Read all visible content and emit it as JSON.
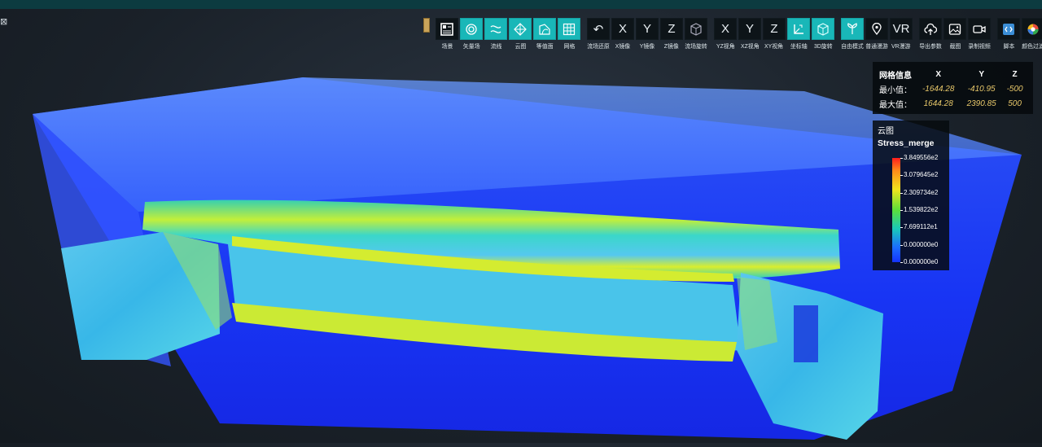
{
  "toolbar": {
    "groups": [
      [
        {
          "name": "scene",
          "label": "场景",
          "icon": "grid-layout-icon",
          "active": false
        },
        {
          "name": "vector-field",
          "label": "矢量场",
          "icon": "vector-swirl-icon",
          "active": true
        },
        {
          "name": "streamline",
          "label": "流线",
          "icon": "streamline-icon",
          "active": true
        },
        {
          "name": "contour",
          "label": "云图",
          "icon": "mesh-cloud-icon",
          "active": true
        },
        {
          "name": "isosurface",
          "label": "等值面",
          "icon": "isosurface-icon",
          "active": true
        },
        {
          "name": "mesh",
          "label": "网格",
          "icon": "mesh-grid-icon",
          "active": true
        }
      ],
      [
        {
          "name": "restore-flow",
          "label": "流场还原",
          "icon": "undo-arrow-icon",
          "glyph": "↶",
          "active": false
        },
        {
          "name": "x-mirror",
          "label": "X镜像",
          "glyph": "X",
          "active": false
        },
        {
          "name": "y-mirror",
          "label": "Y镜像",
          "glyph": "Y",
          "active": false
        },
        {
          "name": "z-mirror",
          "label": "Z镜像",
          "glyph": "Z",
          "active": false
        },
        {
          "name": "rotate-flow",
          "label": "流场旋转",
          "icon": "cube-rotate-icon",
          "active": false
        }
      ],
      [
        {
          "name": "yz-view",
          "label": "YZ视角",
          "glyph": "X",
          "active": false
        },
        {
          "name": "xz-view",
          "label": "XZ视角",
          "glyph": "Y",
          "active": false
        },
        {
          "name": "xy-view",
          "label": "XY视角",
          "glyph": "Z",
          "active": false
        },
        {
          "name": "axes",
          "label": "坐标轴",
          "icon": "axes-icon",
          "active": true
        },
        {
          "name": "rotate-3d",
          "label": "3D旋转",
          "icon": "cube-3d-icon",
          "active": true
        }
      ],
      [
        {
          "name": "free-mode",
          "label": "自由模式",
          "icon": "free-mode-icon",
          "active": true
        },
        {
          "name": "roam",
          "label": "普通漫游",
          "icon": "location-pin-icon",
          "active": false
        },
        {
          "name": "vr-roam",
          "label": "VR漫游",
          "glyph": "VR",
          "active": false
        }
      ],
      [
        {
          "name": "export-params",
          "label": "导出参数",
          "icon": "cloud-upload-icon",
          "active": false
        },
        {
          "name": "screenshot",
          "label": "截图",
          "icon": "image-icon",
          "active": false
        },
        {
          "name": "record-video",
          "label": "录制视频",
          "icon": "video-camera-icon",
          "active": false
        }
      ],
      [
        {
          "name": "script",
          "label": "脚本",
          "icon": "script-icon",
          "active": false
        },
        {
          "name": "color-filter",
          "label": "颜色过滤",
          "icon": "color-wheel-icon",
          "active": false
        }
      ]
    ]
  },
  "grid_info": {
    "title": "网格信息",
    "headers": [
      "X",
      "Y",
      "Z"
    ],
    "min_label": "最小值：",
    "min": [
      "-1644.28",
      "-410.95",
      "-500"
    ],
    "max_label": "最大值：",
    "max": [
      "1644.28",
      "2390.85",
      "500"
    ]
  },
  "legend": {
    "title": "云图",
    "variable": "Stress_merge",
    "labels": [
      "3.849556e2",
      "3.079645e2",
      "2.309734e2",
      "1.539822e2",
      "7.699112e1",
      "0.000000e0",
      "0.000000e0"
    ]
  },
  "colors": {
    "accent": "#19b7b8",
    "panel": "#0d1418",
    "value": "#e8c86a"
  }
}
